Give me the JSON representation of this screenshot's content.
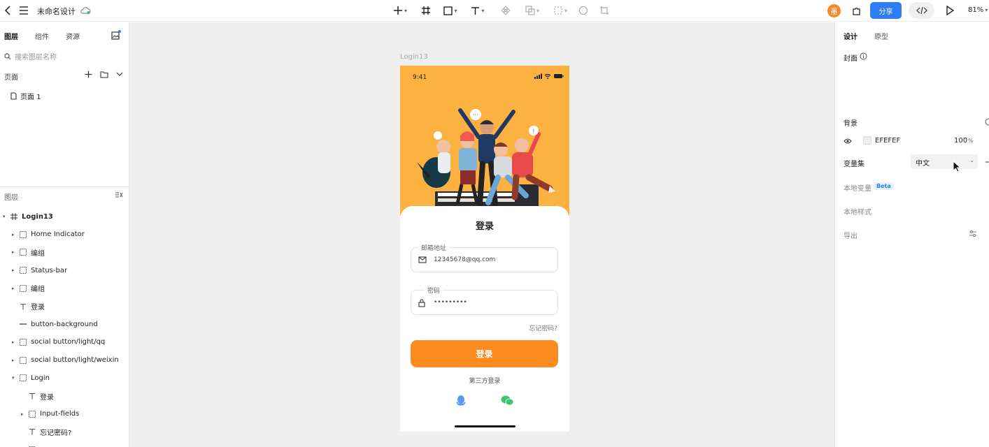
{
  "topbar": {
    "doc_title": "未命名设计",
    "avatar_letter": "墨",
    "share_label": "分享",
    "zoom": "81%"
  },
  "left_panel": {
    "tabs": [
      "图层",
      "组件",
      "资源"
    ],
    "search_placeholder": "搜索图层名称",
    "pages_title": "页面",
    "pages": [
      "页面 1"
    ],
    "layers_title": "图层",
    "layers": [
      {
        "name": "Login13",
        "icon": "frame-icon"
      },
      {
        "name": "Home Indicator",
        "icon": "group-icon"
      },
      {
        "name": "编组",
        "icon": "group-icon"
      },
      {
        "name": "Status-bar",
        "icon": "group-icon"
      },
      {
        "name": "编组",
        "icon": "group-icon"
      },
      {
        "name": "登录",
        "icon": "text-icon"
      },
      {
        "name": "button-background",
        "icon": "rect-icon"
      },
      {
        "name": "social button/light/qq",
        "icon": "group-icon"
      },
      {
        "name": "social button/light/weixin",
        "icon": "group-icon"
      },
      {
        "name": "Login",
        "icon": "group-icon"
      },
      {
        "name": "登录",
        "icon": "text-icon"
      },
      {
        "name": "Input-fields",
        "icon": "group-icon"
      },
      {
        "name": "忘记密码?",
        "icon": "text-icon"
      },
      {
        "name": "第三方登录",
        "icon": "group-icon"
      }
    ]
  },
  "canvas": {
    "frame_label": "Login13",
    "status_time": "9:41",
    "login_title": "登录",
    "email_label": "邮箱地址",
    "email_value": "12345678@qq.com",
    "password_label": "密码",
    "password_value": "•••••••••",
    "forgot": "忘记密码?",
    "login_button": "登录",
    "third_party": "第三方登录"
  },
  "right_panel": {
    "tabs": [
      "设计",
      "原型"
    ],
    "cover_label": "封面",
    "background_label": "背景",
    "bg_hex": "EFEFEF",
    "bg_opacity": "100",
    "bg_opacity_unit": "%",
    "varset_label": "变量集",
    "varset_value": "中文",
    "local_vars_label": "本地变量",
    "beta_badge": "Beta",
    "local_styles_label": "本地样式",
    "export_label": "导出"
  },
  "colors": {
    "accent": "#2e7cf6",
    "hero": "#fcb241",
    "login_button": "#fd8b20",
    "canvas_bg": "#efefef"
  }
}
